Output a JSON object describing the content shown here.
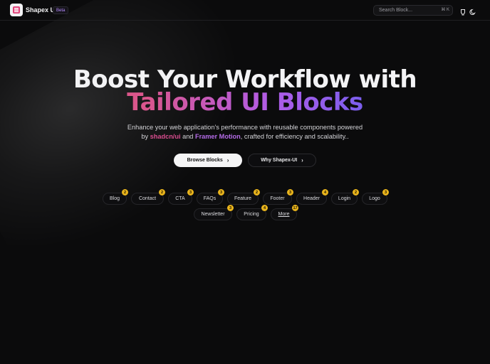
{
  "nav": {
    "brand": "Shapex UI",
    "beta": "Beta",
    "search_placeholder": "Search Block...",
    "search_shortcut": "⌘ K",
    "icons": [
      "github-icon",
      "theme-toggle-icon"
    ]
  },
  "hero": {
    "title_line1": "Boost Your Workflow with",
    "title_line2": "Tailored UI Blocks",
    "subtitle_line1": "Enhance your web application's performance with reusable components powered",
    "subtitle_by": "by ",
    "subtitle_hl1": "shadcn/ui",
    "subtitle_and": " and ",
    "subtitle_hl2": "Framer Motion",
    "subtitle_rest": ", crafted for efficiency and scalability..",
    "primary_button": "Browse Blocks",
    "secondary_button": "Why Shapex-UI"
  },
  "categories": [
    {
      "label": "Blog",
      "count": "2"
    },
    {
      "label": "Contact",
      "count": "2"
    },
    {
      "label": "CTA",
      "count": "3"
    },
    {
      "label": "FAQs",
      "count": "3"
    },
    {
      "label": "Feature",
      "count": "2"
    },
    {
      "label": "Footer",
      "count": "3"
    },
    {
      "label": "Header",
      "count": "4"
    },
    {
      "label": "Login",
      "count": "2"
    },
    {
      "label": "Logo",
      "count": "3"
    },
    {
      "label": "Newsletter",
      "count": "3"
    },
    {
      "label": "Pricing",
      "count": "4"
    },
    {
      "label": "More",
      "count": "17"
    }
  ],
  "colors": {
    "background": "#0b0b0c",
    "badge": "#e9b41c",
    "gradient_start": "#e85a6a",
    "gradient_end": "#5a68ee"
  }
}
